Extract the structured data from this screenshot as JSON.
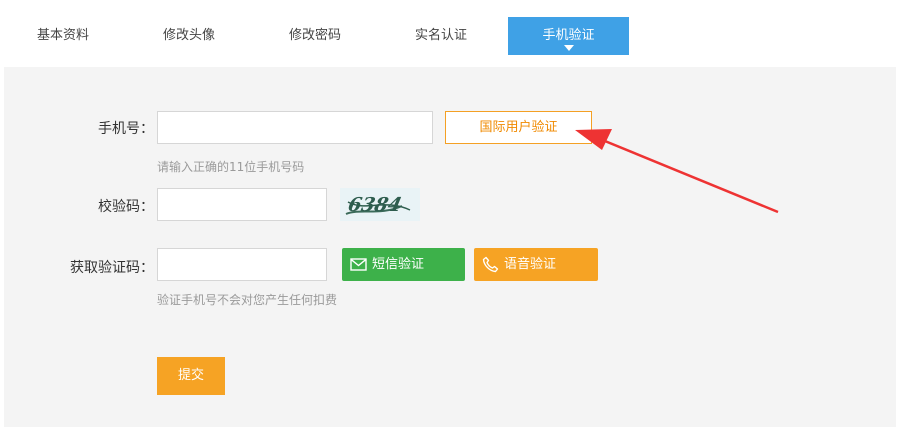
{
  "tabs": [
    {
      "label": "基本资料"
    },
    {
      "label": "修改头像"
    },
    {
      "label": "修改密码"
    },
    {
      "label": "实名认证"
    },
    {
      "label": "手机验证",
      "active": true
    }
  ],
  "form": {
    "phone": {
      "label": "手机号：",
      "value": "",
      "hint": "请输入正确的11位手机号码",
      "intl_button": "国际用户验证"
    },
    "captcha": {
      "label": "校验码：",
      "value": "",
      "image_text": "6384"
    },
    "verify_code": {
      "label": "获取验证码：",
      "value": "",
      "hint": "验证手机号不会对您产生任何扣费",
      "sms_button": "短信验证",
      "voice_button": "语音验证"
    },
    "submit_label": "提交"
  },
  "colors": {
    "tab_active": "#3fa1e6",
    "panel_bg": "#f4f4f4",
    "intl_border": "#f4a024",
    "sms_green": "#3db14a",
    "voice_orange": "#f6a324",
    "annotation_arrow": "#ee3333"
  },
  "icons": {
    "sms": "envelope-icon",
    "voice": "phone-icon",
    "tab_caret": "caret-down-icon"
  }
}
